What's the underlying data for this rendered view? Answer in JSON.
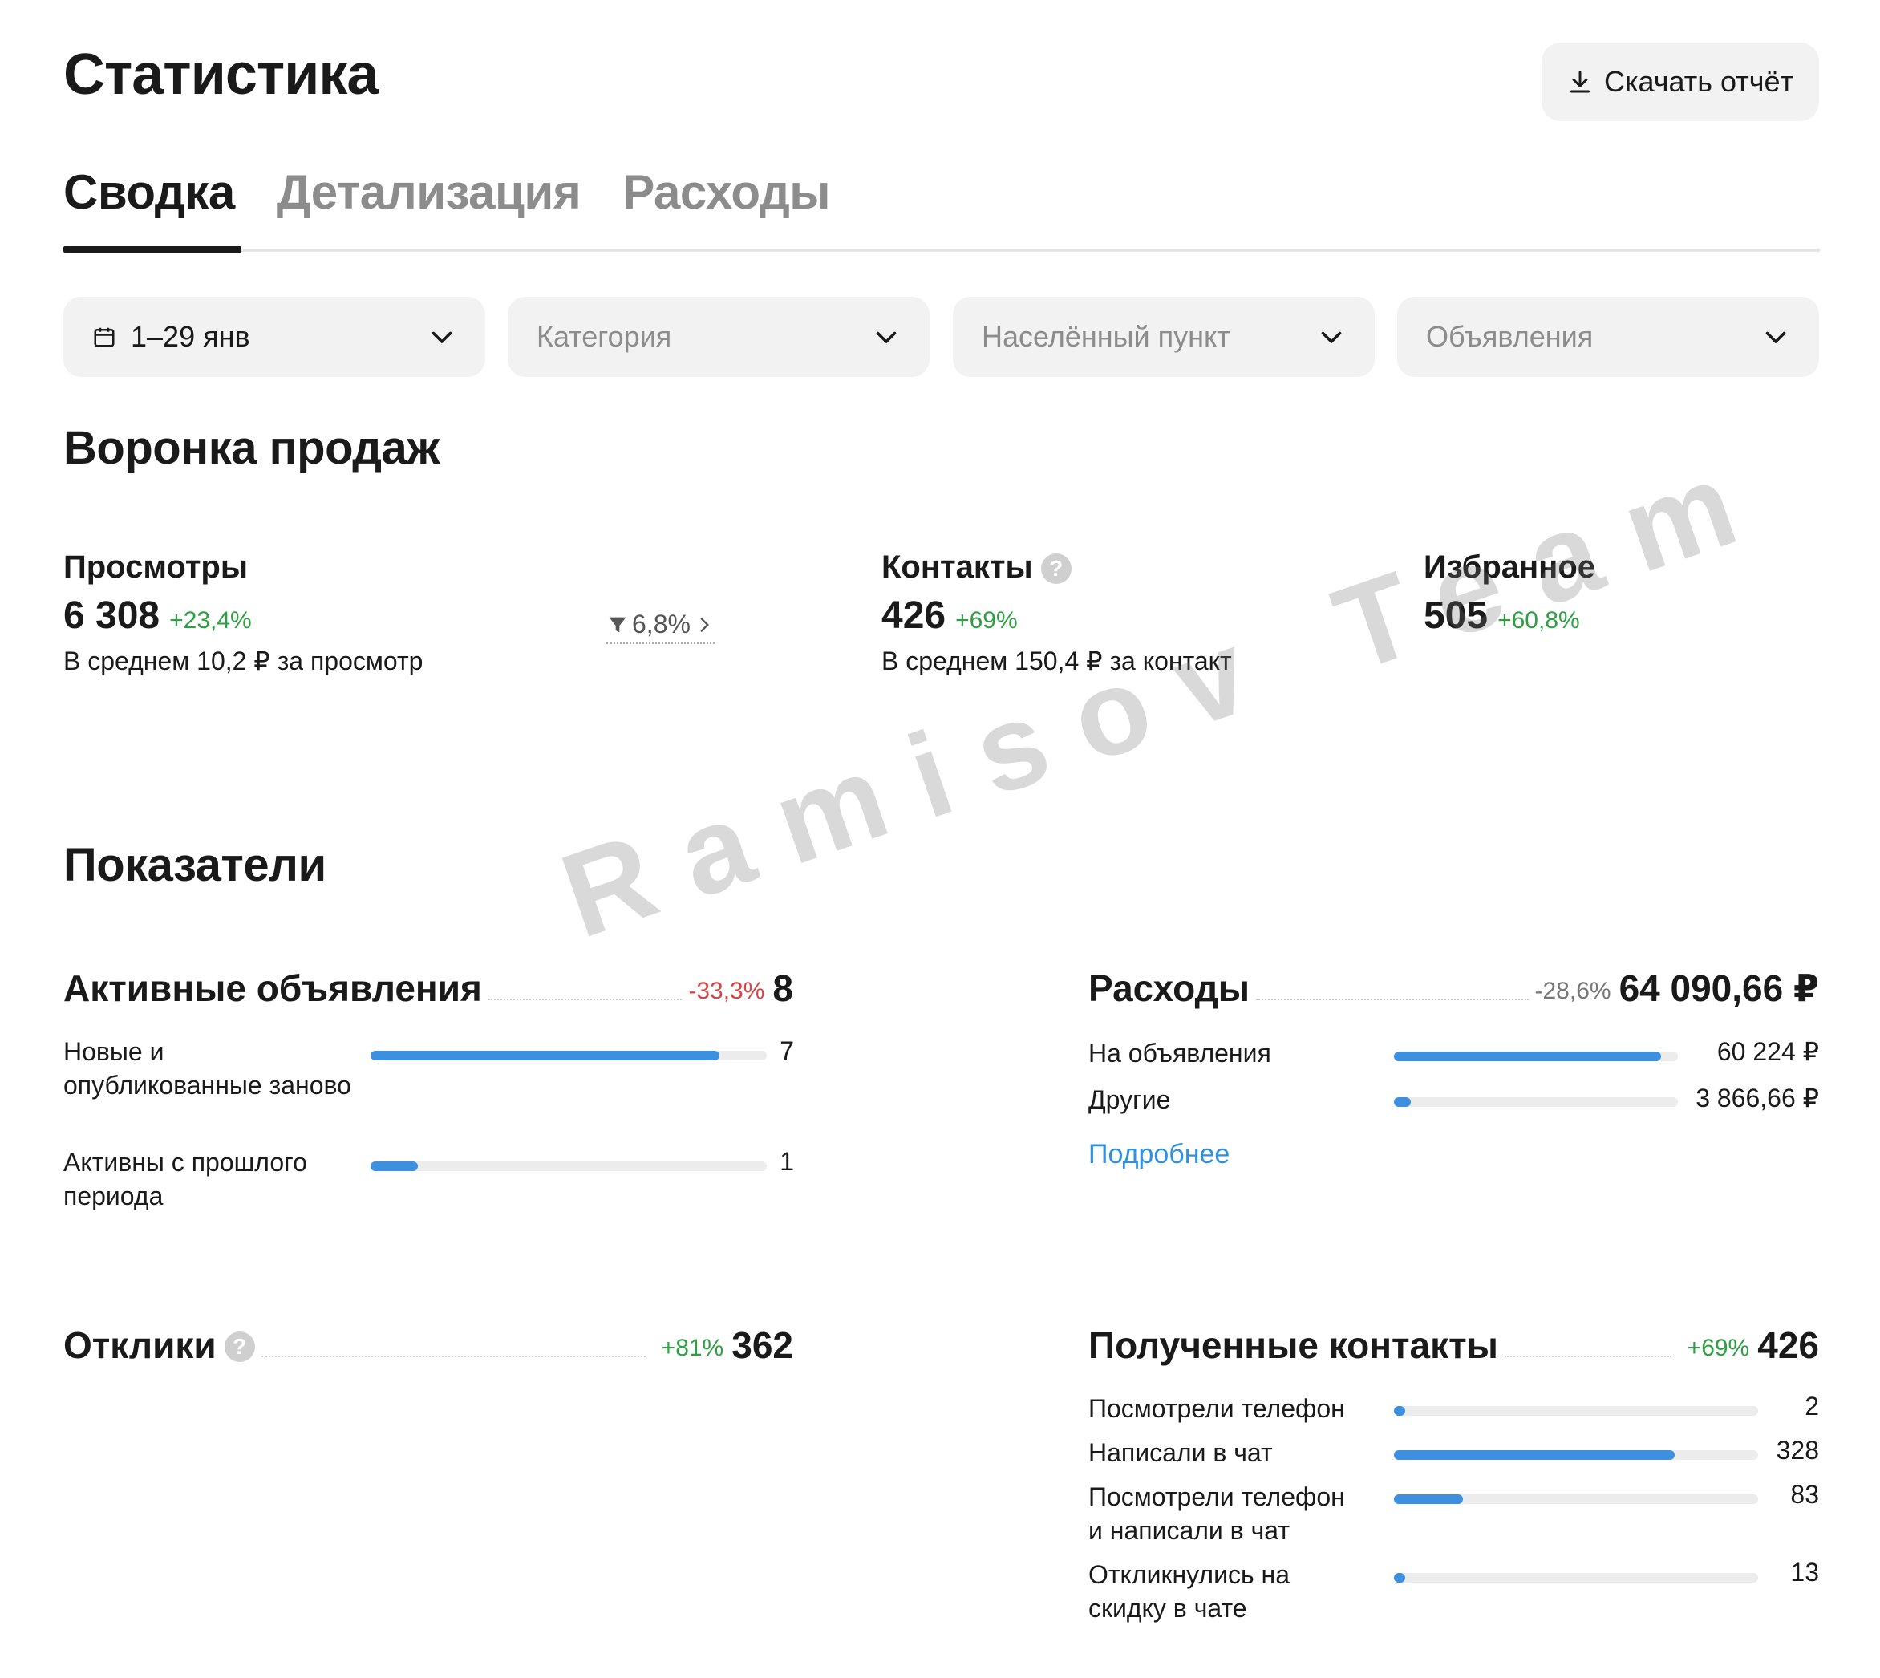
{
  "header": {
    "title": "Статистика",
    "download_label": "Скачать отчёт"
  },
  "tabs": [
    {
      "label": "Сводка",
      "active": true
    },
    {
      "label": "Детализация",
      "active": false
    },
    {
      "label": "Расходы",
      "active": false
    }
  ],
  "filters": {
    "period": "1–29 янв",
    "category": "Категория",
    "location": "Населённый пункт",
    "ads": "Объявления"
  },
  "funnel": {
    "title": "Воронка продаж",
    "views": {
      "label": "Просмотры",
      "value": "6 308",
      "change": "+23,4%",
      "sub": "В среднем 10,2 ₽ за просмотр"
    },
    "conversion": "6,8%",
    "contacts": {
      "label": "Контакты",
      "value": "426",
      "change": "+69%",
      "sub": "В среднем 150,4 ₽ за контакт"
    },
    "favorites": {
      "label": "Избранное",
      "value": "505",
      "change": "+60,8%"
    }
  },
  "indicators": {
    "title": "Показатели",
    "active_ads": {
      "title": "Активные объявления",
      "change": "-33,3%",
      "total": "8",
      "rows": [
        {
          "label": "Новые и опубликованные заново",
          "value": "7",
          "fill": 0.88
        },
        {
          "label": "Активны с прошлого периода",
          "value": "1",
          "fill": 0.12
        }
      ]
    },
    "expenses": {
      "title": "Расходы",
      "change": "-28,6%",
      "total": "64 090,66 ₽",
      "rows": [
        {
          "label": "На объявления",
          "value": "60 224 ₽",
          "fill": 0.94
        },
        {
          "label": "Другие",
          "value": "3 866,66 ₽",
          "fill": 0.06
        }
      ],
      "more_link": "Подробнее"
    },
    "responses": {
      "title": "Отклики",
      "change": "+81%",
      "total": "362"
    },
    "contacts": {
      "title": "Полученные контакты",
      "change": "+69%",
      "total": "426",
      "rows": [
        {
          "label": "Посмотрели телефон",
          "value": "2",
          "fill": 0.03
        },
        {
          "label": "Написали в чат",
          "value": "328",
          "fill": 0.77
        },
        {
          "label": "Посмотрели телефон и написали в чат",
          "value": "83",
          "fill": 0.19
        },
        {
          "label": "Откликнулись на скидку в чате",
          "value": "13",
          "fill": 0.03
        }
      ]
    }
  },
  "watermark": "Ramisov Team",
  "colors": {
    "accent": "#3d8fe0",
    "positive": "#2ea043",
    "negative": "#d64545",
    "link": "#2f8fe0"
  }
}
